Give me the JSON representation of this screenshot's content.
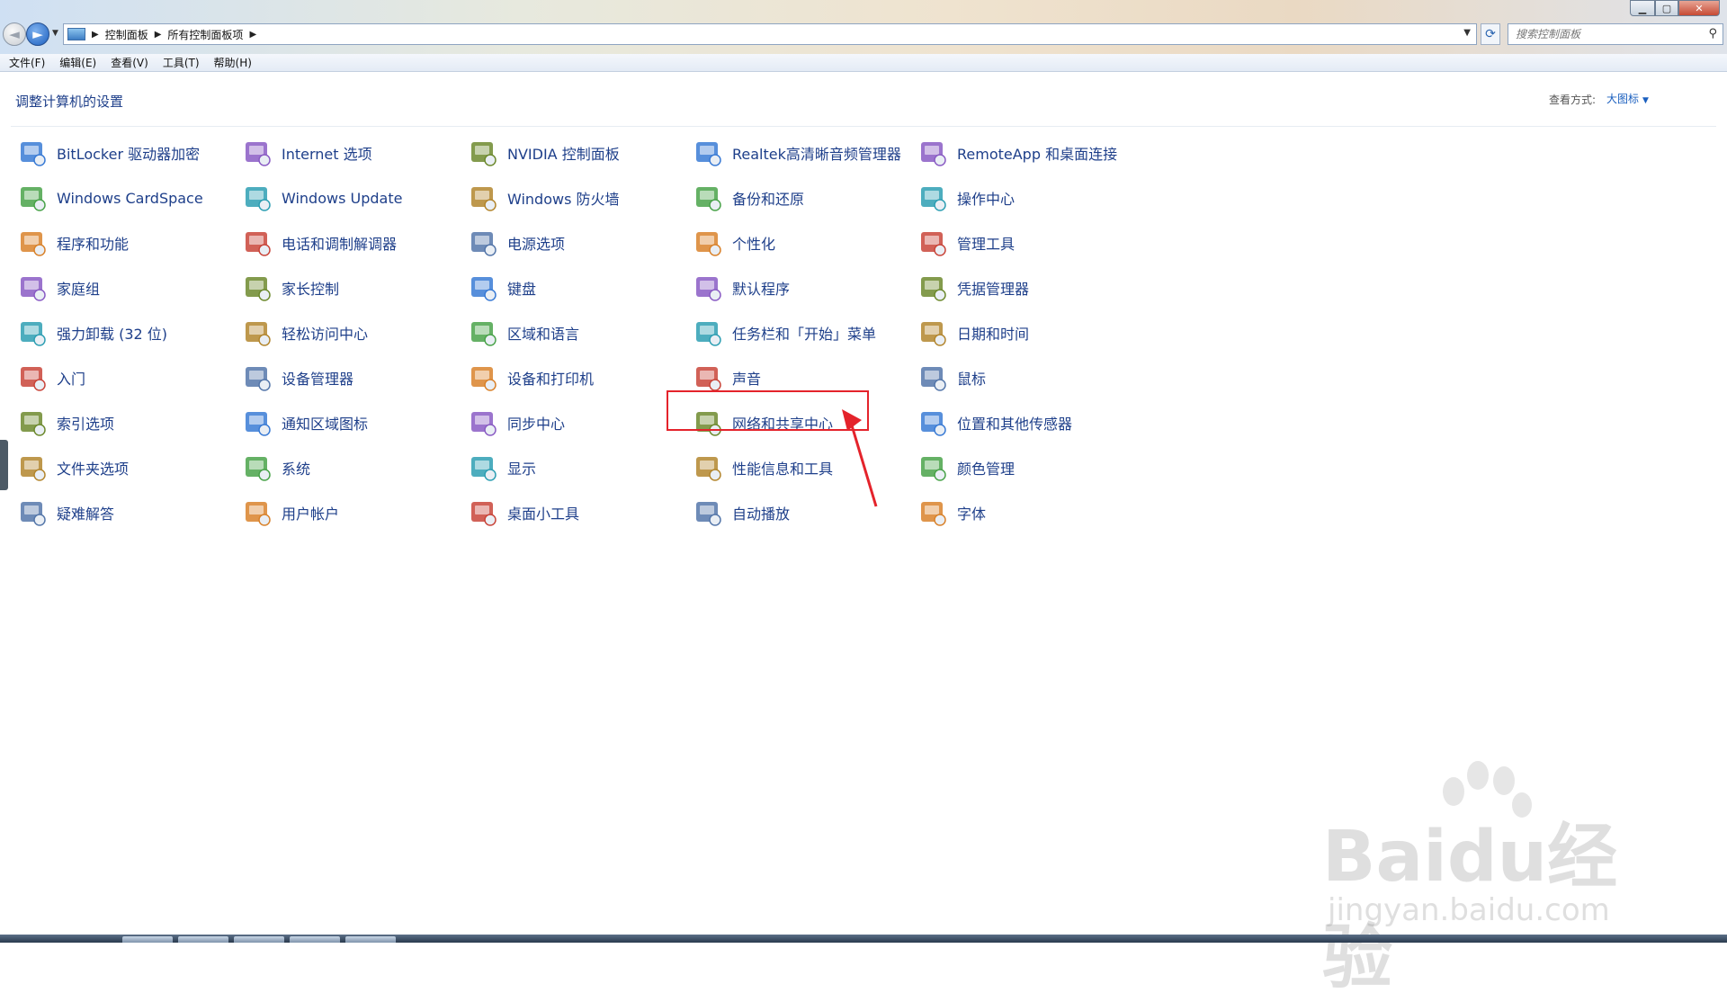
{
  "address_bar": {
    "breadcrumbs": [
      "控制面板",
      "所有控制面板项"
    ],
    "search_placeholder": "搜索控制面板"
  },
  "menu": [
    "文件(F)",
    "编辑(E)",
    "查看(V)",
    "工具(T)",
    "帮助(H)"
  ],
  "header": {
    "title": "调整计算机的设置",
    "view_label": "查看方式:",
    "view_value": "大图标"
  },
  "columns": [
    [
      {
        "label": "BitLocker 驱动器加密",
        "icon": "key-lock-icon"
      },
      {
        "label": "Windows CardSpace",
        "icon": "cardspace-icon"
      },
      {
        "label": "程序和功能",
        "icon": "programs-icon"
      },
      {
        "label": "家庭组",
        "icon": "homegroup-icon"
      },
      {
        "label": "强力卸载 (32 位)",
        "icon": "uninstall-icon"
      },
      {
        "label": "入门",
        "icon": "getting-started-icon"
      },
      {
        "label": "索引选项",
        "icon": "indexing-icon"
      },
      {
        "label": "文件夹选项",
        "icon": "folder-options-icon"
      },
      {
        "label": "疑难解答",
        "icon": "troubleshoot-icon"
      }
    ],
    [
      {
        "label": "Internet 选项",
        "icon": "internet-options-icon"
      },
      {
        "label": "Windows Update",
        "icon": "windows-update-icon"
      },
      {
        "label": "电话和调制解调器",
        "icon": "phone-modem-icon"
      },
      {
        "label": "家长控制",
        "icon": "parental-control-icon"
      },
      {
        "label": "轻松访问中心",
        "icon": "ease-of-access-icon"
      },
      {
        "label": "设备管理器",
        "icon": "device-manager-icon"
      },
      {
        "label": "通知区域图标",
        "icon": "notification-icons-icon"
      },
      {
        "label": "系统",
        "icon": "system-icon"
      },
      {
        "label": "用户帐户",
        "icon": "user-accounts-icon"
      }
    ],
    [
      {
        "label": "NVIDIA 控制面板",
        "icon": "nvidia-icon"
      },
      {
        "label": "Windows 防火墙",
        "icon": "firewall-icon"
      },
      {
        "label": "电源选项",
        "icon": "power-options-icon"
      },
      {
        "label": "键盘",
        "icon": "keyboard-icon"
      },
      {
        "label": "区域和语言",
        "icon": "region-language-icon"
      },
      {
        "label": "设备和打印机",
        "icon": "printer-icon"
      },
      {
        "label": "同步中心",
        "icon": "sync-center-icon"
      },
      {
        "label": "显示",
        "icon": "display-icon"
      },
      {
        "label": "桌面小工具",
        "icon": "desktop-gadgets-icon"
      }
    ],
    [
      {
        "label": "Realtek高清晰音频管理器",
        "icon": "realtek-audio-icon"
      },
      {
        "label": "备份和还原",
        "icon": "backup-restore-icon"
      },
      {
        "label": "个性化",
        "icon": "personalization-icon"
      },
      {
        "label": "默认程序",
        "icon": "default-programs-icon"
      },
      {
        "label": "任务栏和「开始」菜单",
        "icon": "taskbar-start-icon"
      },
      {
        "label": "声音",
        "icon": "sound-icon"
      },
      {
        "label": "网络和共享中心",
        "icon": "network-sharing-icon"
      },
      {
        "label": "性能信息和工具",
        "icon": "performance-icon"
      },
      {
        "label": "自动播放",
        "icon": "autoplay-icon"
      }
    ],
    [
      {
        "label": "RemoteApp 和桌面连接",
        "icon": "remoteapp-icon"
      },
      {
        "label": "操作中心",
        "icon": "action-center-icon"
      },
      {
        "label": "管理工具",
        "icon": "admin-tools-icon"
      },
      {
        "label": "凭据管理器",
        "icon": "credential-manager-icon"
      },
      {
        "label": "日期和时间",
        "icon": "date-time-icon"
      },
      {
        "label": "鼠标",
        "icon": "mouse-icon"
      },
      {
        "label": "位置和其他传感器",
        "icon": "location-sensors-icon"
      },
      {
        "label": "颜色管理",
        "icon": "color-management-icon"
      },
      {
        "label": "字体",
        "icon": "fonts-icon"
      }
    ]
  ],
  "watermark": {
    "brand": "Baidu经验",
    "url": "jingyan.baidu.com"
  }
}
